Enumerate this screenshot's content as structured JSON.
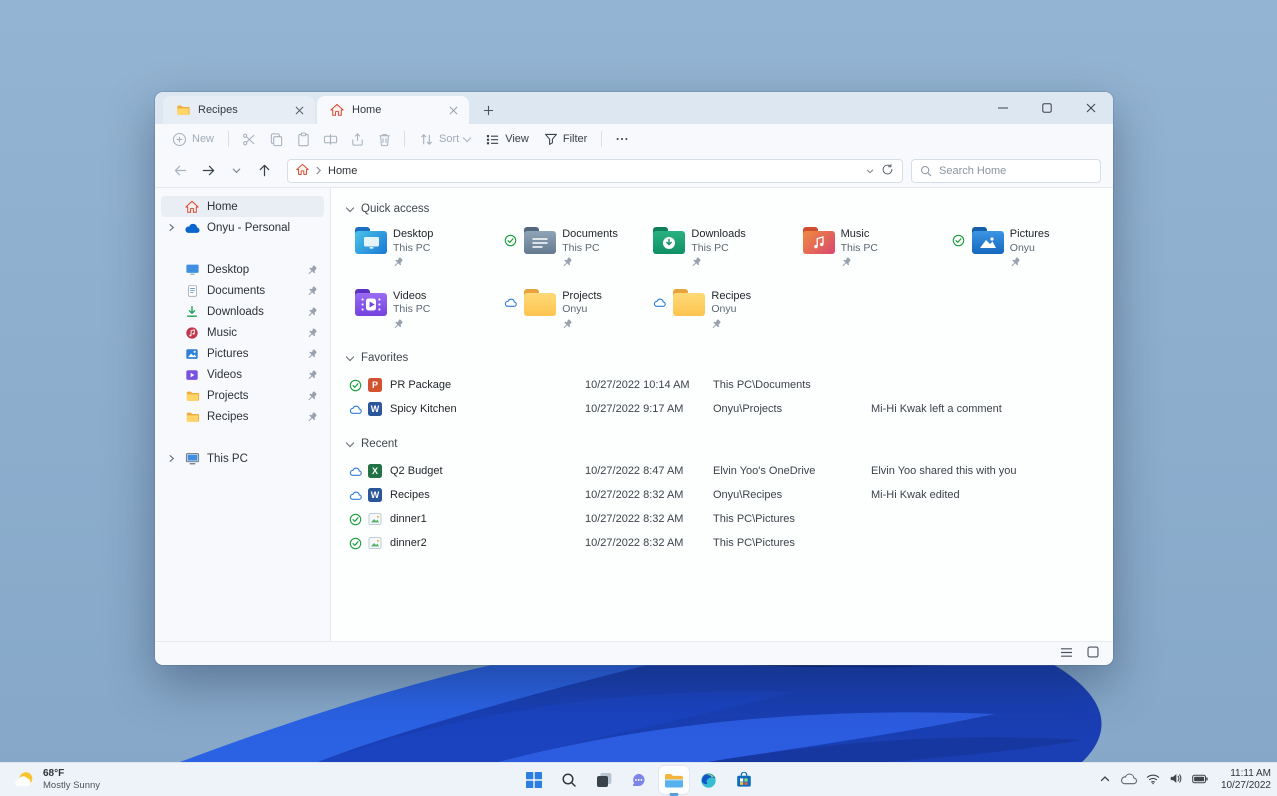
{
  "colors": {
    "accent_blue": "#0067c0",
    "wallpaper_sky": "#8cadcc",
    "bloom_dark": "#081c63",
    "bloom_bright": "#2b62e4",
    "folder_yellow": "#fdc44e",
    "synced_green": "#18a03c",
    "cloud_blue": "#2f7cd6"
  },
  "window": {
    "tabs": [
      {
        "label": "Recipes",
        "icon": "folder-icon",
        "active": false
      },
      {
        "label": "Home",
        "icon": "home-icon",
        "active": true
      }
    ],
    "toolbar": {
      "new_label": "New",
      "sort_label": "Sort",
      "view_label": "View",
      "filter_label": "Filter",
      "more_label": "..."
    },
    "nav": {
      "breadcrumb_root": "Home",
      "search_placeholder": "Search Home"
    },
    "sidebar": {
      "groups": [
        {
          "items": [
            {
              "label": "Home",
              "icon": "home",
              "active": true,
              "expandable": false,
              "pinned": false
            },
            {
              "label": "Onyu - Personal",
              "icon": "onedrive",
              "active": false,
              "expandable": true,
              "pinned": false
            }
          ]
        },
        {
          "items": [
            {
              "label": "Desktop",
              "icon": "desktop",
              "active": false,
              "expandable": false,
              "pinned": true
            },
            {
              "label": "Documents",
              "icon": "documents",
              "active": false,
              "expandable": false,
              "pinned": true
            },
            {
              "label": "Downloads",
              "icon": "downloads",
              "active": false,
              "expandable": false,
              "pinned": true
            },
            {
              "label": "Music",
              "icon": "music",
              "active": false,
              "expandable": false,
              "pinned": true
            },
            {
              "label": "Pictures",
              "icon": "pictures",
              "active": false,
              "expandable": false,
              "pinned": true
            },
            {
              "label": "Videos",
              "icon": "videos",
              "active": false,
              "expandable": false,
              "pinned": true
            },
            {
              "label": "Projects",
              "icon": "folder",
              "active": false,
              "expandable": false,
              "pinned": true
            },
            {
              "label": "Recipes",
              "icon": "folder",
              "active": false,
              "expandable": false,
              "pinned": true
            }
          ]
        },
        {
          "items": [
            {
              "label": "This PC",
              "icon": "thispc",
              "active": false,
              "expandable": true,
              "pinned": false
            }
          ]
        }
      ]
    },
    "quick_access": {
      "title": "Quick access",
      "tiles": [
        {
          "name": "Desktop",
          "location": "This PC",
          "folder": "desktop",
          "status": "none",
          "pinned": true
        },
        {
          "name": "Documents",
          "location": "This PC",
          "folder": "documents",
          "status": "synced",
          "pinned": true
        },
        {
          "name": "Downloads",
          "location": "This PC",
          "folder": "downloads",
          "status": "none",
          "pinned": true
        },
        {
          "name": "Music",
          "location": "This PC",
          "folder": "music",
          "status": "none",
          "pinned": true
        },
        {
          "name": "Pictures",
          "location": "Onyu",
          "folder": "pictures",
          "status": "synced",
          "pinned": true
        },
        {
          "name": "Videos",
          "location": "This PC",
          "folder": "videos",
          "status": "none",
          "pinned": true
        },
        {
          "name": "Projects",
          "location": "Onyu",
          "folder": "folder",
          "status": "cloud",
          "pinned": true
        },
        {
          "name": "Recipes",
          "location": "Onyu",
          "folder": "folder",
          "status": "cloud",
          "pinned": true
        }
      ]
    },
    "favorites": {
      "title": "Favorites",
      "rows": [
        {
          "name": "PR Package",
          "date": "10/27/2022 10:14 AM",
          "location": "This PC\\Documents",
          "activity": "",
          "file": "powerpoint",
          "status": "synced"
        },
        {
          "name": "Spicy Kitchen",
          "date": "10/27/2022 9:17 AM",
          "location": "Onyu\\Projects",
          "activity": "Mi-Hi Kwak left a comment",
          "file": "word",
          "status": "cloud"
        }
      ]
    },
    "recent": {
      "title": "Recent",
      "rows": [
        {
          "name": "Q2 Budget",
          "date": "10/27/2022 8:47 AM",
          "location": "Elvin Yoo's OneDrive",
          "activity": "Elvin Yoo shared this with you",
          "file": "excel",
          "status": "cloud"
        },
        {
          "name": "Recipes",
          "date": "10/27/2022 8:32 AM",
          "location": "Onyu\\Recipes",
          "activity": "Mi-Hi Kwak edited",
          "file": "word",
          "status": "cloud"
        },
        {
          "name": "dinner1",
          "date": "10/27/2022 8:32 AM",
          "location": "This PC\\Pictures",
          "activity": "",
          "file": "image",
          "status": "synced"
        },
        {
          "name": "dinner2",
          "date": "10/27/2022 8:32 AM",
          "location": "This PC\\Pictures",
          "activity": "",
          "file": "image",
          "status": "synced"
        }
      ]
    }
  },
  "taskbar": {
    "weather": {
      "temp": "68°F",
      "condition": "Mostly Sunny"
    },
    "apps": [
      "start",
      "search",
      "task-view",
      "chat",
      "file-explorer",
      "edge",
      "store"
    ],
    "active_app": "file-explorer",
    "tray_icons": [
      "hidden-icons-chevron",
      "onedrive",
      "wifi",
      "volume",
      "battery"
    ],
    "clock": {
      "time": "11:11 AM",
      "date": "10/27/2022"
    }
  }
}
